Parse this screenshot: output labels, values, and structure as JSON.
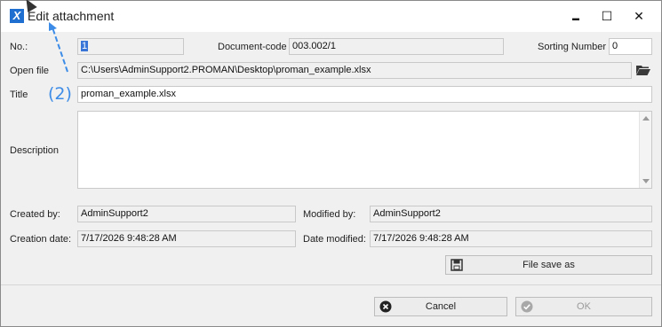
{
  "window": {
    "title": "Edit attachment",
    "app_icon_letter": "X",
    "controls": {
      "minimize": "▬",
      "maximize": "☐",
      "close": "✕"
    }
  },
  "annotation": {
    "step_label": "(2)"
  },
  "form": {
    "no_label": "No.:",
    "no_value": "1",
    "document_code_label": "Document-code",
    "document_code_value": "003.002/1",
    "sorting_label": "Sorting Number",
    "sorting_value": "0",
    "open_file_label": "Open file",
    "open_file_value": "C:\\Users\\AdminSupport2.PROMAN\\Desktop\\proman_example.xlsx",
    "title_label": "Title",
    "title_value": "proman_example.xlsx",
    "description_label": "Description",
    "description_value": "",
    "created_by_label": "Created by:",
    "created_by_value": "AdminSupport2",
    "modified_by_label": "Modified by:",
    "modified_by_value": "AdminSupport2",
    "creation_date_label": "Creation date:",
    "creation_date_value": "7/17/2026 9:48:28 AM",
    "date_modified_label": "Date modified:",
    "date_modified_value": "7/17/2026 9:48:28 AM"
  },
  "buttons": {
    "file_save_as": "File save as",
    "cancel": "Cancel",
    "ok": "OK"
  },
  "colors": {
    "accent": "#1e6fcf",
    "annotation": "#3c8ce7",
    "selection": "#3875d7"
  }
}
